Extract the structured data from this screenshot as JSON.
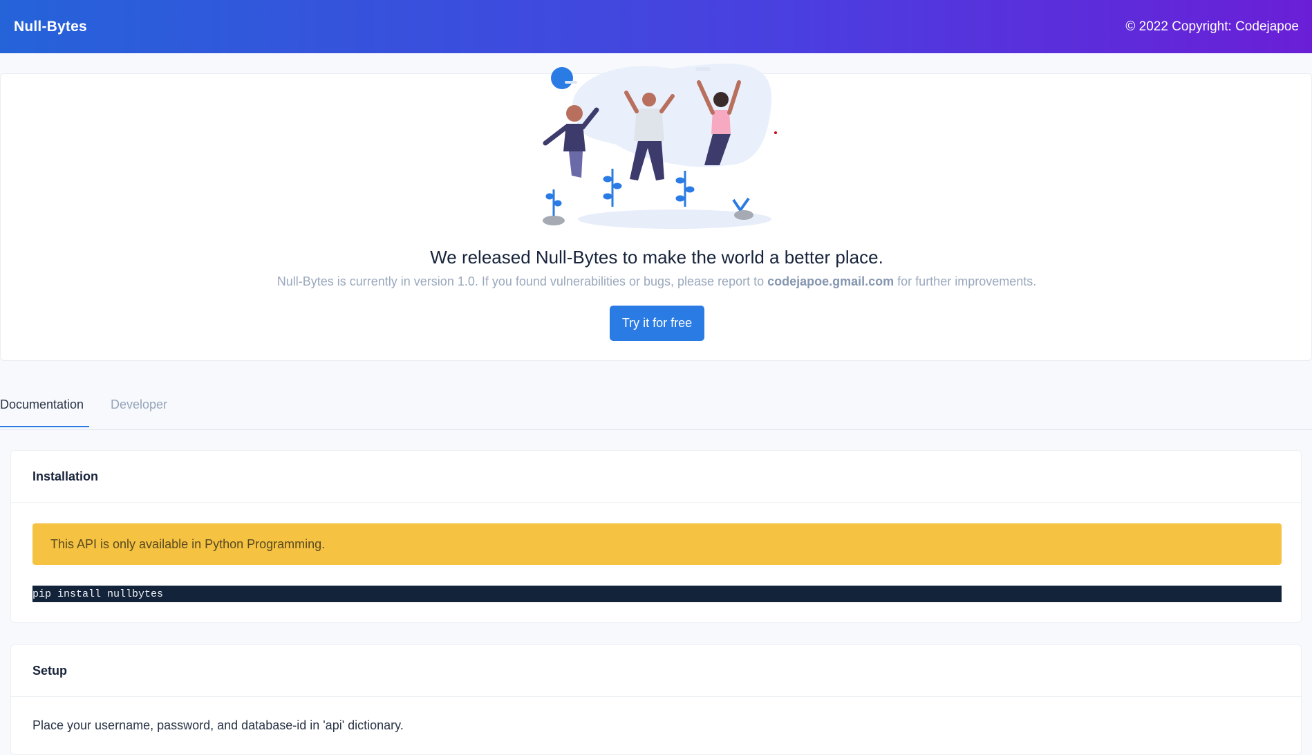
{
  "header": {
    "brand": "Null-Bytes",
    "copyright": "© 2022 Copyright: Codejapoe"
  },
  "hero": {
    "title": "We released Null-Bytes to make the world a better place.",
    "subtitle_before": "Null-Bytes is currently in version 1.0. If you found vulnerabilities or bugs, please report to ",
    "email": "codejapoe.gmail.com",
    "subtitle_after": " for further improvements.",
    "cta_label": "Try it for free",
    "illustration": "people-jumping-illustration"
  },
  "tabs": [
    {
      "label": "Documentation",
      "active": true
    },
    {
      "label": "Developer",
      "active": false
    }
  ],
  "installation": {
    "heading": "Installation",
    "alert": "This API is only available in Python Programming.",
    "code": "pip install nullbytes"
  },
  "setup": {
    "heading": "Setup",
    "text": "Place your username, password, and database-id in 'api' dictionary."
  },
  "colors": {
    "header_gradient_start": "#2563d9",
    "header_gradient_end": "#6a1fd6",
    "primary": "#2a7be4",
    "warning": "#f5c242",
    "code_bg": "#13233a"
  }
}
